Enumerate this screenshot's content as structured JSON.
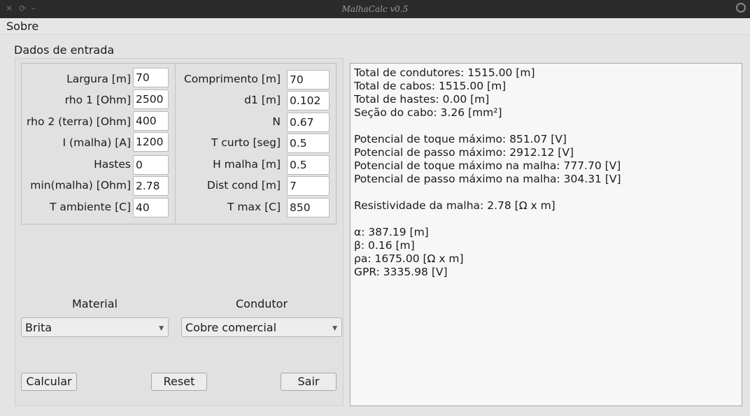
{
  "window": {
    "title": "MalhaCalc v0.5"
  },
  "menu": {
    "sobre": "Sobre"
  },
  "group": {
    "title": "Dados de entrada"
  },
  "inputs_left": [
    {
      "label": "Largura [m]",
      "value": "70"
    },
    {
      "label": "rho 1 [Ohm]",
      "value": "2500"
    },
    {
      "label": "rho 2 (terra) [Ohm]",
      "value": "400"
    },
    {
      "label": "I (malha) [A]",
      "value": "1200"
    },
    {
      "label": "Hastes",
      "value": "0"
    },
    {
      "label": "min(malha) [Ohm]",
      "value": "2.78"
    },
    {
      "label": "T ambiente [C]",
      "value": "40"
    }
  ],
  "inputs_right": [
    {
      "label": "Comprimento [m]",
      "value": "70"
    },
    {
      "label": "d1 [m]",
      "value": "0.102"
    },
    {
      "label": "N",
      "value": "0.67"
    },
    {
      "label": "T curto [seg]",
      "value": "0.5"
    },
    {
      "label": "H malha [m]",
      "value": "0.5"
    },
    {
      "label": "Dist cond [m]",
      "value": "7"
    },
    {
      "label": "T max [C]",
      "value": "850"
    }
  ],
  "material": {
    "label": "Material",
    "selected": "Brita"
  },
  "condutor": {
    "label": "Condutor",
    "selected": "Cobre comercial"
  },
  "buttons": {
    "calcular": "Calcular",
    "reset": "Reset",
    "sair": "Sair"
  },
  "results": {
    "block1": [
      "Total de condutores: 1515.00 [m]",
      "Total de cabos: 1515.00 [m]",
      "Total de hastes: 0.00 [m]",
      "Seção do cabo: 3.26 [mm²]"
    ],
    "block2": [
      "Potencial de toque máximo: 851.07 [V]",
      "Potencial de passo máximo: 2912.12 [V]",
      "Potencial de toque máximo na malha: 777.70 [V]",
      "Potencial de passo máximo na malha: 304.31 [V]"
    ],
    "block3": [
      "Resistividade da malha: 2.78 [Ω x m]"
    ],
    "block4": [
      "α: 387.19 [m]",
      "β: 0.16 [m]",
      "ρa: 1675.00 [Ω x m]",
      "GPR: 3335.98 [V]"
    ]
  }
}
